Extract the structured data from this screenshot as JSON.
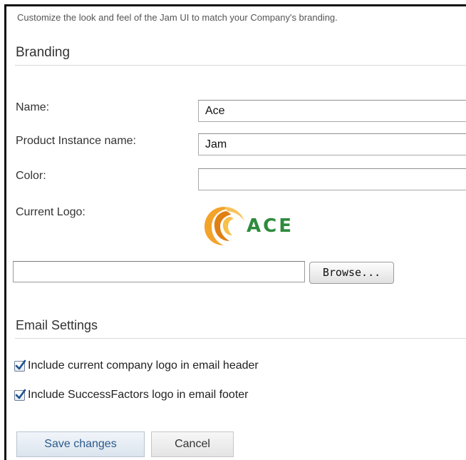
{
  "description": "Customize the look and feel of the Jam UI to match your Company's branding.",
  "branding": {
    "title": "Branding",
    "fields": {
      "name": {
        "label": "Name:",
        "value": "Ace"
      },
      "instance": {
        "label": "Product Instance name:",
        "value": "Jam"
      },
      "color": {
        "label": "Color:",
        "value": ""
      }
    },
    "logo": {
      "label": "Current Logo:",
      "text": "ACE",
      "icon": "ace-swirl-logo-icon"
    },
    "upload": {
      "browse_label": "Browse..."
    }
  },
  "email": {
    "title": "Email Settings",
    "options": [
      {
        "label": "Include current company logo in email header",
        "checked": true
      },
      {
        "label": "Include SuccessFactors logo in email footer",
        "checked": true
      }
    ]
  },
  "actions": {
    "save_label": "Save changes",
    "cancel_label": "Cancel"
  },
  "colors": {
    "logo_orange": "#e8961e",
    "logo_green": "#2e8b3c",
    "checkmark": "#1f4f8f",
    "save_text": "#2a5a8c"
  }
}
